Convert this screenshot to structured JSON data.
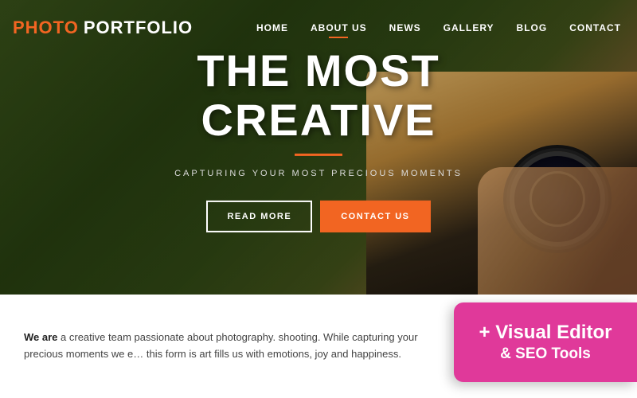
{
  "header": {
    "logo": {
      "photo": "PHOTO",
      "portfolio": "PORTFOLIO"
    },
    "nav": {
      "items": [
        {
          "label": "HOME",
          "active": false
        },
        {
          "label": "ABOUT US",
          "active": true
        },
        {
          "label": "NEWS",
          "active": false
        },
        {
          "label": "GALLERY",
          "active": false
        },
        {
          "label": "BLOG",
          "active": false
        },
        {
          "label": "CONTACT",
          "active": false
        }
      ]
    }
  },
  "hero": {
    "title": "THE MOST CREATIVE",
    "subtitle": "CAPTURING YOUR MOST PRECIOUS MOMENTS",
    "btn_read_more": "READ MORE",
    "btn_contact": "CONTACT US"
  },
  "bottom": {
    "text_part1": "We",
    "text_part2": "are",
    "text_full": "We are a creative team passionate about photography. shooting. While capturing your precious moments we e... this form is art fills us with emotions, joy and happiness."
  },
  "badge": {
    "line1": "+ Visual Editor",
    "line2": "& SEO Tools"
  }
}
